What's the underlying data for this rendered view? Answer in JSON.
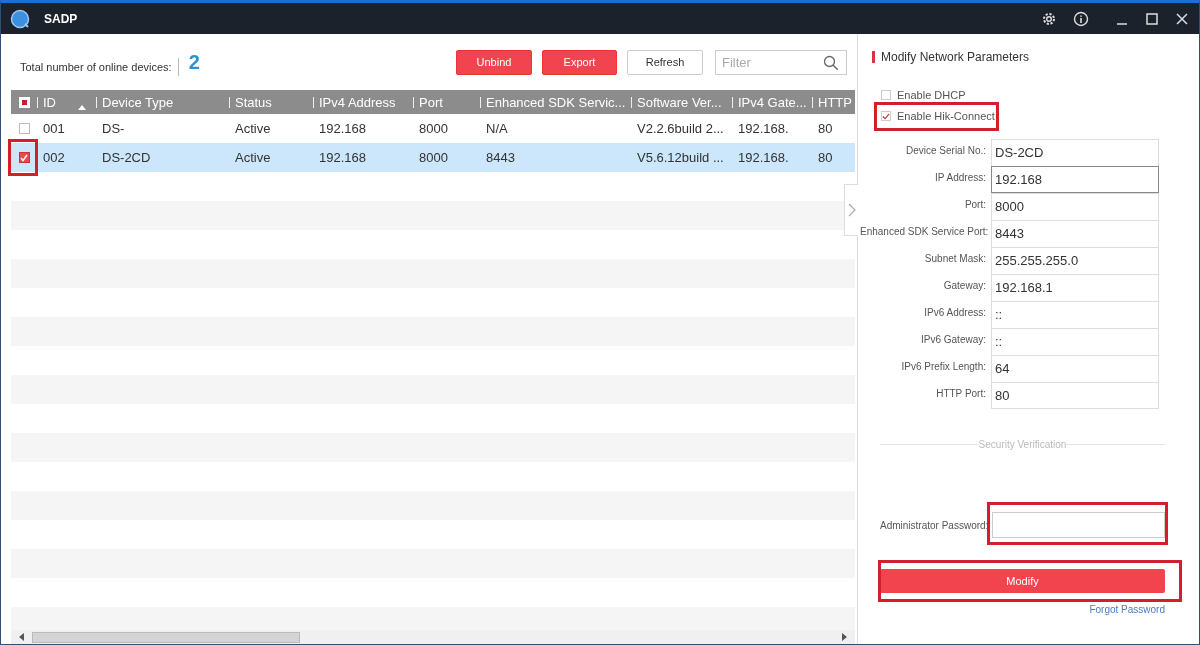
{
  "window": {
    "title": "SADP"
  },
  "summary": {
    "label": "Total number of online devices:",
    "count": "2"
  },
  "toolbar": {
    "buttons": [
      {
        "label": "Unbind",
        "kind": "primary"
      },
      {
        "label": "Export",
        "kind": "primary"
      },
      {
        "label": "Refresh",
        "kind": "secondary"
      }
    ],
    "filter": {
      "placeholder": "Filter"
    }
  },
  "table": {
    "header_checkbox": {
      "partial": true
    },
    "columns": [
      {
        "label": "ID",
        "sorted": true
      },
      {
        "label": "Device Type",
        "sorted": false
      },
      {
        "label": "Status",
        "sorted": false
      },
      {
        "label": "IPv4 Address",
        "sorted": false
      },
      {
        "label": "Port",
        "sorted": false
      },
      {
        "label": "Enhanced SDK Servic...",
        "sorted": false
      },
      {
        "label": "Software Ver...",
        "sorted": false
      },
      {
        "label": "IPv4 Gate...",
        "sorted": false
      },
      {
        "label": "HTTP",
        "sorted": false
      }
    ],
    "rows": [
      {
        "checked": false,
        "selected": false,
        "highlighted": false,
        "cells": [
          "001",
          "DS-",
          "Active",
          "192.168",
          "8000",
          "N/A",
          "V2.2.6build 2...",
          "192.168.",
          "80"
        ]
      },
      {
        "checked": true,
        "selected": true,
        "highlighted": true,
        "cells": [
          "002",
          "DS-2CD",
          "Active",
          "192.168",
          "8000",
          "8443",
          "V5.6.12build ...",
          "192.168.",
          "80"
        ]
      }
    ]
  },
  "panel": {
    "title": "Modify Network Parameters",
    "options": [
      {
        "label": "Enable DHCP",
        "checked": false,
        "highlighted": false
      },
      {
        "label": "Enable Hik-Connect",
        "checked": true,
        "highlighted": true
      }
    ],
    "fields": [
      {
        "label": "Device Serial No.:",
        "value": "DS-2CD",
        "focused": false
      },
      {
        "label": "IP Address:",
        "value": "192.168",
        "focused": true
      },
      {
        "label": "Port:",
        "value": "8000",
        "focused": false
      },
      {
        "label": "Enhanced SDK Service Port:",
        "value": "8443",
        "focused": false
      },
      {
        "label": "Subnet Mask:",
        "value": "255.255.255.0",
        "focused": false
      },
      {
        "label": "Gateway:",
        "value": "192.168.1",
        "focused": false
      },
      {
        "label": "IPv6 Address:",
        "value": "::",
        "focused": false
      },
      {
        "label": "IPv6 Gateway:",
        "value": "::",
        "focused": false
      },
      {
        "label": "IPv6 Prefix Length:",
        "value": "64",
        "focused": false
      },
      {
        "label": "HTTP Port:",
        "value": "80",
        "focused": false
      }
    ],
    "section": "Security Verification",
    "password": {
      "label": "Administrator Password:",
      "highlighted": true
    },
    "submit": {
      "label": "Modify",
      "highlighted": true
    },
    "link": "Forgot Password"
  }
}
